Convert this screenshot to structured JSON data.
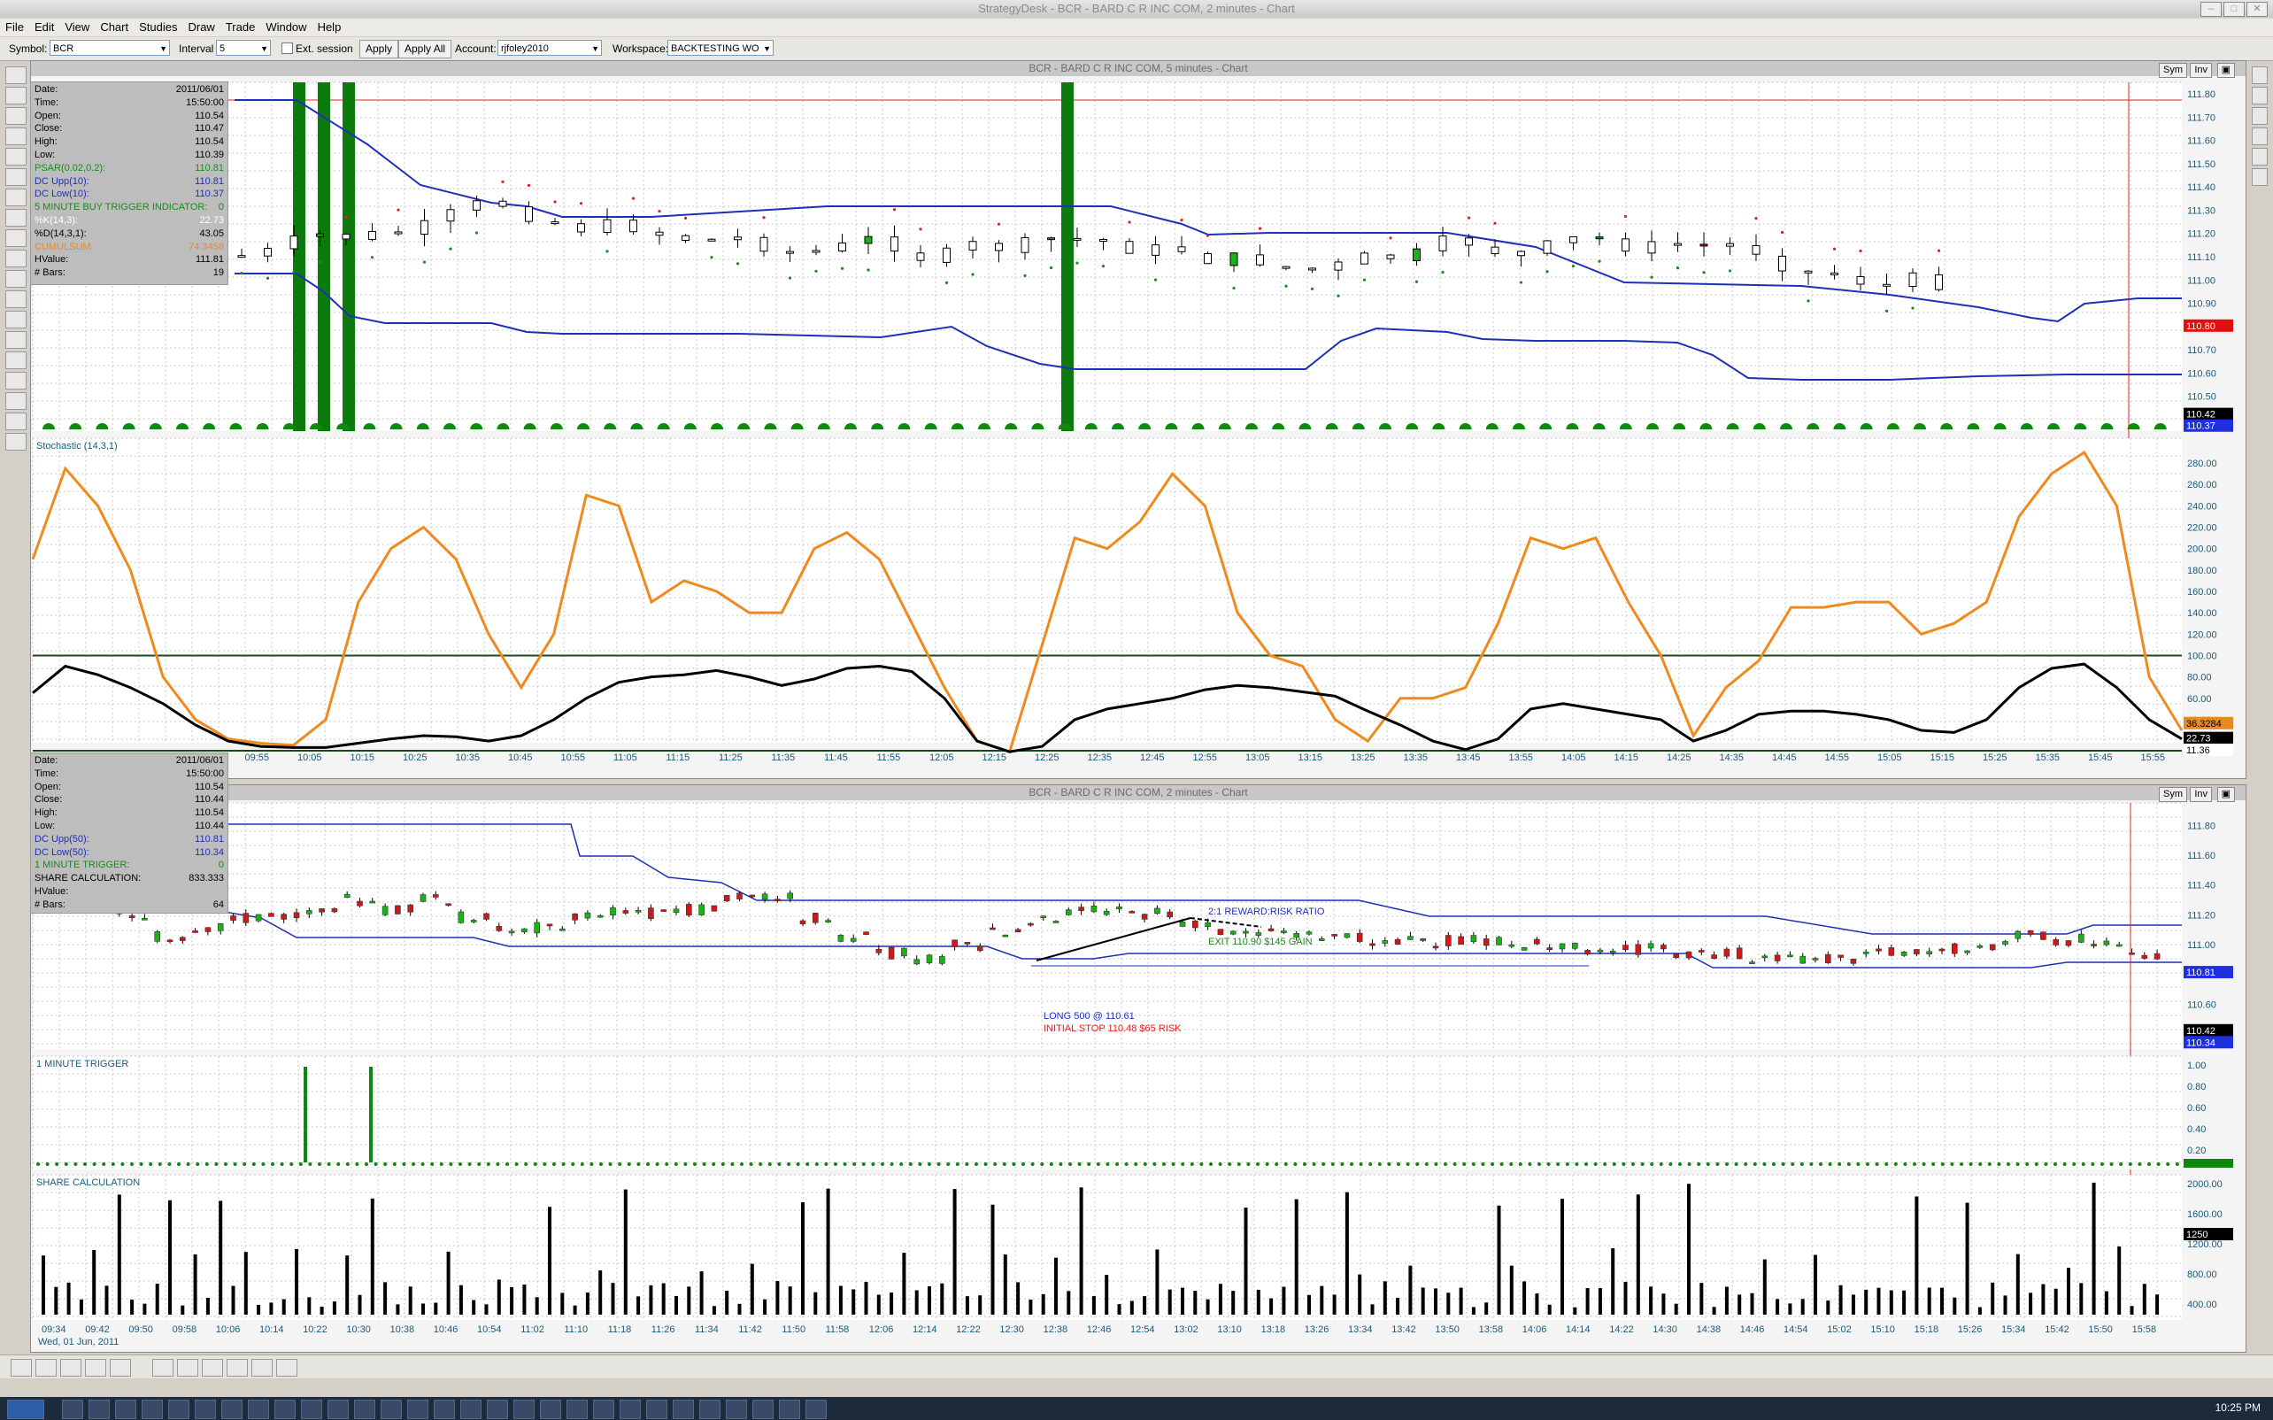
{
  "window": {
    "title": "StrategyDesk - BCR - BARD C R INC COM, 2 minutes - Chart",
    "clock": "10:25 PM"
  },
  "menu": [
    "File",
    "Edit",
    "View",
    "Chart",
    "Studies",
    "Draw",
    "Trade",
    "Window",
    "Help"
  ],
  "toolbar": {
    "symbol_label": "Symbol:",
    "symbol_value": "BCR",
    "interval_label": "Interval",
    "interval_value": "5",
    "ext_session_label": "Ext. session",
    "apply_label": "Apply",
    "apply_all_label": "Apply All",
    "account_label": "Account:",
    "account_value": "rjfoley2010",
    "workspace_label": "Workspace:",
    "workspace_value": "BACKTESTING WO"
  },
  "chart_top": {
    "title": "BCR - BARD C R INC COM, 5 minutes - Chart",
    "sym_button": "Sym",
    "inv_button": "Inv",
    "info": [
      {
        "k": "Date:",
        "v": "2011/06/01"
      },
      {
        "k": "Time:",
        "v": "15:50:00"
      },
      {
        "k": "Open:",
        "v": "110.54"
      },
      {
        "k": "Close:",
        "v": "110.47"
      },
      {
        "k": "High:",
        "v": "110.54"
      },
      {
        "k": "Low:",
        "v": "110.39"
      },
      {
        "k": "PSAR(0.02,0.2):",
        "v": "110.81",
        "color": "#1a8a1a"
      },
      {
        "k": "DC Upp(10):",
        "v": "110.81",
        "color": "#1e2fb8"
      },
      {
        "k": "DC Low(10):",
        "v": "110.37",
        "color": "#1e2fb8"
      },
      {
        "k": "5 MINUTE BUY TRIGGER INDICATOR:",
        "v": "0",
        "color": "#1a8a1a"
      },
      {
        "k": "%K(14,3):",
        "v": "22.73",
        "color": "#ffffff"
      },
      {
        "k": "%D(14,3,1):",
        "v": "43.05"
      },
      {
        "k": "CUMULSUM:",
        "v": "74.3458",
        "color": "#e88a1e"
      },
      {
        "k": "HValue:",
        "v": "111.81"
      },
      {
        "k": "# Bars:",
        "v": "19"
      }
    ],
    "price_axis": [
      "111.80",
      "111.70",
      "111.60",
      "111.50",
      "111.40",
      "111.30",
      "111.20",
      "111.10",
      "111.00",
      "110.90",
      "110.80",
      "110.70",
      "110.60",
      "110.50",
      "110.40"
    ],
    "badges": [
      {
        "text": "110.80",
        "bg": "#e01010",
        "fg": "#ffffff"
      },
      {
        "text": "110.42",
        "bg": "#000000",
        "fg": "#ffffff"
      },
      {
        "text": "110.37",
        "bg": "#1e2fe0",
        "fg": "#ffffff"
      }
    ],
    "stoch_label": "Stochastic (14,3,1)",
    "stoch_axis": [
      "280.00",
      "260.00",
      "240.00",
      "220.00",
      "200.00",
      "180.00",
      "160.00",
      "140.00",
      "120.00",
      "100.00",
      "80.00",
      "60.00",
      "40.00"
    ],
    "stoch_badges": [
      {
        "text": "36.3284",
        "bg": "#e88a1e",
        "fg": "#000000"
      },
      {
        "text": "22.73",
        "bg": "#000000",
        "fg": "#ffffff"
      },
      {
        "text": "11.36",
        "bg": "#ffffff",
        "fg": "#000000"
      }
    ],
    "time_axis": [
      "09:45",
      "09:55",
      "10:05",
      "10:15",
      "10:25",
      "10:35",
      "10:45",
      "10:55",
      "11:05",
      "11:15",
      "11:25",
      "11:35",
      "11:45",
      "11:55",
      "12:05",
      "12:15",
      "12:25",
      "12:35",
      "12:45",
      "12:55",
      "13:05",
      "13:15",
      "13:25",
      "13:35",
      "13:45",
      "13:55",
      "14:05",
      "14:15",
      "14:25",
      "14:35",
      "14:45",
      "14:55",
      "15:05",
      "15:15",
      "15:25",
      "15:35",
      "15:45",
      "15:55"
    ]
  },
  "chart_bottom": {
    "title": "BCR - BARD C R INC COM, 2 minutes - Chart",
    "sym_button": "Sym",
    "inv_button": "Inv",
    "info": [
      {
        "k": "Date:",
        "v": "2011/06/01"
      },
      {
        "k": "Time:",
        "v": "15:50:00"
      },
      {
        "k": "Open:",
        "v": "110.54"
      },
      {
        "k": "Close:",
        "v": "110.44"
      },
      {
        "k": "High:",
        "v": "110.54"
      },
      {
        "k": "Low:",
        "v": "110.44"
      },
      {
        "k": "DC Upp(50):",
        "v": "110.81",
        "color": "#1e2fb8"
      },
      {
        "k": "DC Low(50):",
        "v": "110.34",
        "color": "#1e2fb8"
      },
      {
        "k": "1 MINUTE TRIGGER:",
        "v": "0",
        "color": "#1a8a1a"
      },
      {
        "k": "SHARE CALCULATION:",
        "v": "833.333"
      },
      {
        "k": "HValue:",
        "v": ""
      },
      {
        "k": "# Bars:",
        "v": "64"
      }
    ],
    "price_axis": [
      "111.80",
      "111.60",
      "111.40",
      "111.20",
      "111.00",
      "110.80",
      "110.60",
      "110.40"
    ],
    "badges": [
      {
        "text": "110.81",
        "bg": "#1e2fe0",
        "fg": "#ffffff"
      },
      {
        "text": "110.42",
        "bg": "#000000",
        "fg": "#ffffff"
      },
      {
        "text": "110.34",
        "bg": "#1e2fe0",
        "fg": "#ffffff"
      }
    ],
    "annotations": {
      "reward": "2:1 REWARD:RISK RATIO",
      "exit": "EXIT 110.90 $145 GAIN",
      "long": "LONG 500 @ 110.61",
      "stop": "INITIAL STOP 110.48 $65 RISK"
    },
    "trigger_label": "1 MINUTE TRIGGER",
    "trigger_axis": [
      "1.00",
      "0.80",
      "0.60",
      "0.40",
      "0.20"
    ],
    "share_label": "SHARE CALCULATION",
    "share_axis": [
      "2000.00",
      "1600.00",
      "1200.00",
      "800.00",
      "400.00"
    ],
    "share_badge": "1250",
    "time_axis": [
      "09:34",
      "09:42",
      "09:50",
      "09:58",
      "10:06",
      "10:14",
      "10:22",
      "10:30",
      "10:38",
      "10:46",
      "10:54",
      "11:02",
      "11:10",
      "11:18",
      "11:26",
      "11:34",
      "11:42",
      "11:50",
      "11:58",
      "12:06",
      "12:14",
      "12:22",
      "12:30",
      "12:38",
      "12:46",
      "12:54",
      "13:02",
      "13:10",
      "13:18",
      "13:26",
      "13:34",
      "13:42",
      "13:50",
      "13:58",
      "14:06",
      "14:14",
      "14:22",
      "14:30",
      "14:38",
      "14:46",
      "14:54",
      "15:02",
      "15:10",
      "15:18",
      "15:26",
      "15:34",
      "15:42",
      "15:50",
      "15:58"
    ],
    "date_label": "Wed, 01 Jun, 2011"
  },
  "colors": {
    "candle_up": "#17b417",
    "candle_down": "#d01818",
    "channel": "#1e2fb8",
    "k_line": "#000000",
    "d_line": "#ee8a1e",
    "trigger": "#0a8a0a"
  }
}
